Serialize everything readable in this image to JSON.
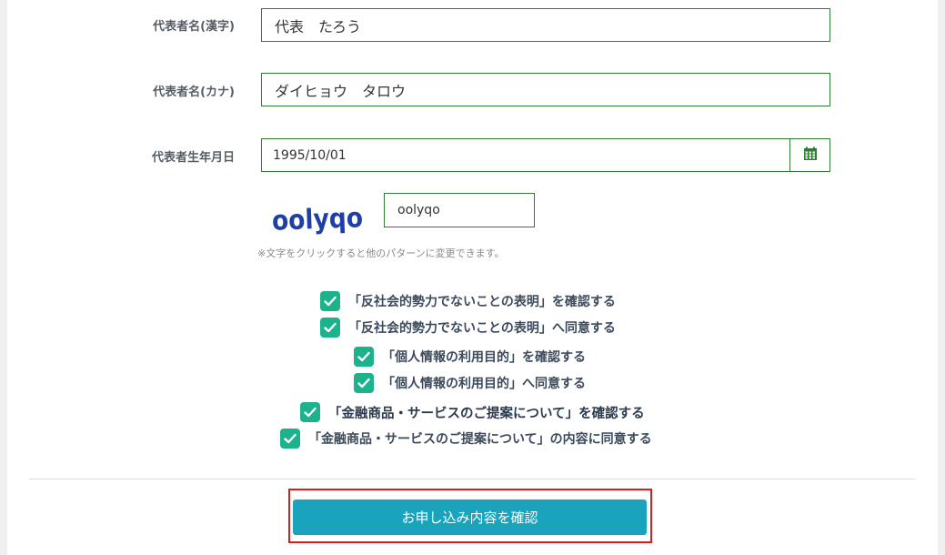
{
  "form": {
    "rep_name_kanji": {
      "label": "代表者名(漢字)",
      "value": "代表　たろう"
    },
    "rep_name_kana": {
      "label": "代表者名(カナ)",
      "value": "ダイヒョウ　タロウ"
    },
    "rep_birthdate": {
      "label": "代表者生年月日",
      "value": "1995/10/01",
      "icon": "calendar-icon"
    },
    "captcha": {
      "image_text": "oolyqo",
      "value": "oolyqo",
      "note": "※文字をクリックすると他のパターンに変更できます。"
    }
  },
  "consents": [
    {
      "text": "「反社会的勢力でないことの表明」を確認する",
      "checked": true
    },
    {
      "text": "「反社会的勢力でないことの表明」へ同意する",
      "checked": true
    },
    {
      "text": "「個人情報の利用目的」を確認する",
      "checked": true
    },
    {
      "text": "「個人情報の利用目的」へ同意する",
      "checked": true
    },
    {
      "text": "「金融商品・サービスのご提案について」を確認する",
      "checked": true
    },
    {
      "text": "「金融商品・サービスのご提案について」の内容に同意する",
      "checked": true
    }
  ],
  "submit": {
    "label": "お申し込み内容を確認"
  },
  "colors": {
    "field_border": "#2e7d32",
    "checkbox": "#1cb28b",
    "button": "#1aa3bd",
    "highlight": "#e01b1b",
    "captcha_text": "#1f3fa6"
  }
}
